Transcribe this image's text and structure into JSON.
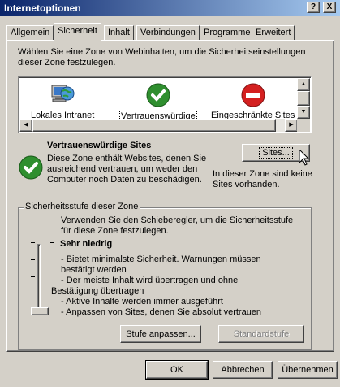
{
  "window": {
    "title": "Internetoptionen",
    "help_glyph": "?",
    "close_glyph": "X"
  },
  "tabs": [
    {
      "label": "Allgemein",
      "active": false
    },
    {
      "label": "Sicherheit",
      "active": true
    },
    {
      "label": "Inhalt",
      "active": false
    },
    {
      "label": "Verbindungen",
      "active": false
    },
    {
      "label": "Programme",
      "active": false
    },
    {
      "label": "Erweitert",
      "active": false
    }
  ],
  "security": {
    "intro": "Wählen Sie eine Zone von Webinhalten, um die Sicherheitseinstellungen dieser Zone festzulegen.",
    "zones": [
      {
        "label": "Lokales Intranet",
        "icon": "intranet-globe-icon",
        "selected": false
      },
      {
        "label": "Vertrauenswürdige",
        "icon": "trusted-check-icon",
        "selected": true
      },
      {
        "label": "Eingeschränkte Sites",
        "icon": "restricted-no-entry-icon",
        "selected": false
      }
    ],
    "selected_zone": {
      "title": "Vertrauenswürdige Sites",
      "description": "Diese Zone enthält Websites, denen Sie ausreichend vertrauen, um weder den Computer noch Daten zu beschädigen.",
      "sites_button": "Sites...",
      "no_sites_text": "In dieser Zone sind keine Sites vorhanden."
    },
    "level_group": {
      "label": "Sicherheitsstufe dieser Zone",
      "slider_intro": "Verwenden Sie den Schieberegler, um die Sicherheitsstufe für diese Zone festzulegen.",
      "level_name": "Sehr niedrig",
      "level_lines": [
        "- Bietet minimalste Sicherheit. Warnungen müssen",
        "  bestätigt werden",
        "- Der meiste Inhalt wird übertragen und ohne",
        "Bestätigung übertragen",
        "- Aktive Inhalte werden immer ausgeführt",
        "- Anpassen von Sites, denen Sie absolut vertrauen"
      ],
      "slider_level_index": 0,
      "slider_level_count": 5,
      "customize_button": "Stufe anpassen...",
      "default_button": "Standardstufe"
    }
  },
  "footer": {
    "ok": "OK",
    "cancel": "Abbrechen",
    "apply": "Übernehmen"
  },
  "colors": {
    "titlebar_start": "#0a246a",
    "titlebar_end": "#a6caf0",
    "face": "#d4d0c8",
    "trusted_green": "#2f8f2f",
    "restricted_red": "#d42020"
  }
}
